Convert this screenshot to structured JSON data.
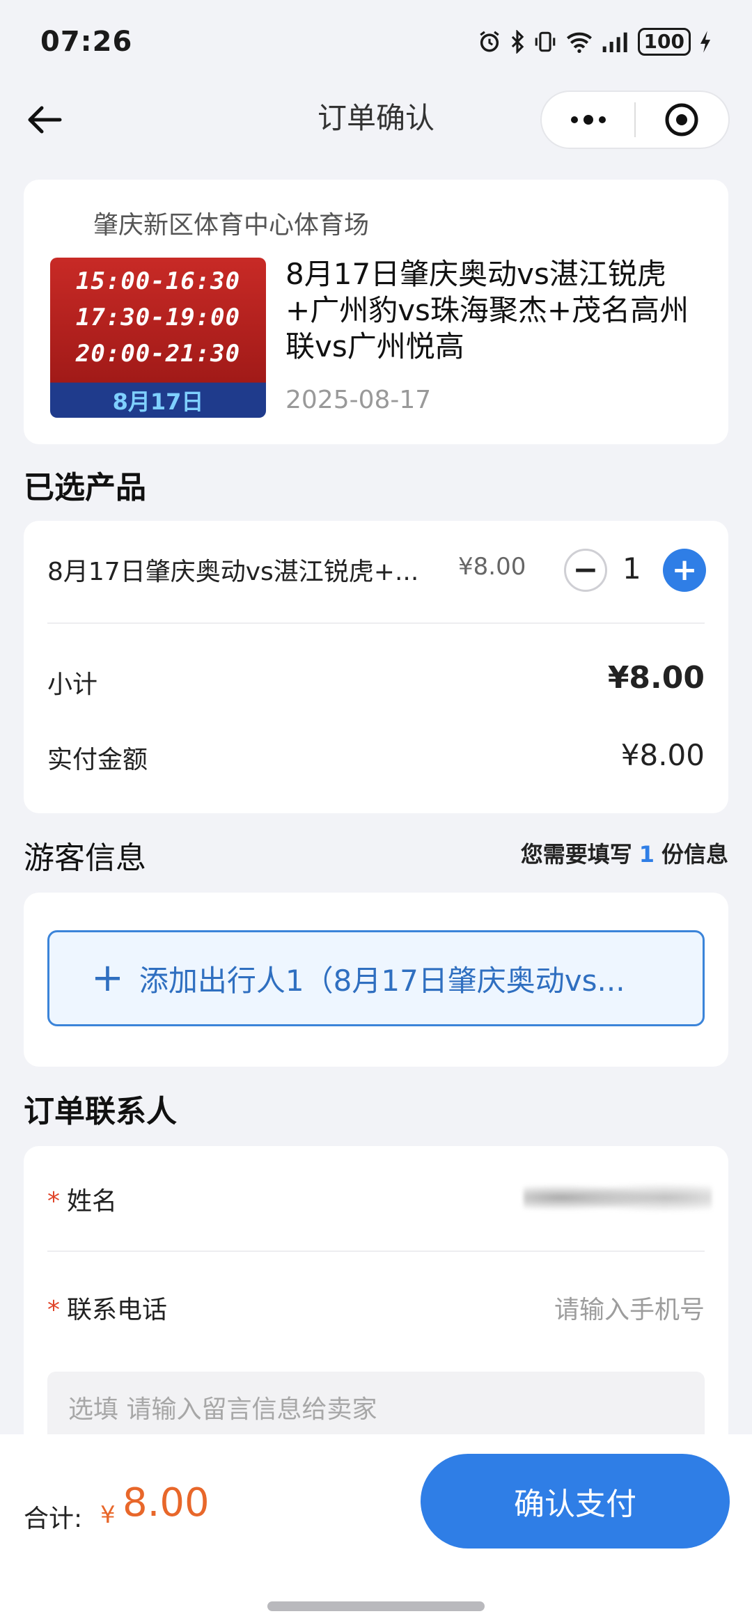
{
  "status_bar": {
    "time": "07:26",
    "battery": "100"
  },
  "nav": {
    "title": "订单确认"
  },
  "event": {
    "venue": "肇庆新区体育中心体育场",
    "poster_times": [
      "15:00-16:30",
      "17:30-19:00",
      "20:00-21:30"
    ],
    "poster_date": "8月17日",
    "title": "8月17日肇庆奥动vs湛江锐虎+广州豹vs珠海聚杰+茂名高州联vs广州悦高",
    "date": "2025-08-17"
  },
  "selected_products": {
    "section_title": "已选产品",
    "item": {
      "name": "8月17日肇庆奥动vs湛江锐虎+...",
      "price": "¥8.00",
      "quantity": "1",
      "minus_label": "−",
      "plus_label": "+"
    },
    "subtotal_label": "小计",
    "subtotal_value": "¥8.00",
    "paid_label": "实付金额",
    "paid_value": "¥8.00"
  },
  "visitor_info": {
    "section_title": "游客信息",
    "need_prefix": "您需要填写",
    "need_count": "1",
    "need_suffix": "份信息",
    "add_plus": "+",
    "add_label": "添加出行人1（8月17日肇庆奥动vs..."
  },
  "contact": {
    "section_title": "订单联系人",
    "required_mark": "*",
    "name_label": "姓名",
    "phone_label": "联系电话",
    "phone_placeholder": "请输入手机号",
    "message_placeholder": "选填 请输入留言信息给卖家"
  },
  "bottom_bar": {
    "total_label": "合计:",
    "currency": "¥",
    "total_value": "8.00",
    "pay_button": "确认支付"
  },
  "colors": {
    "accent_blue": "#2f7ee6",
    "price_orange": "#e8672a",
    "required_red": "#e0452a"
  }
}
